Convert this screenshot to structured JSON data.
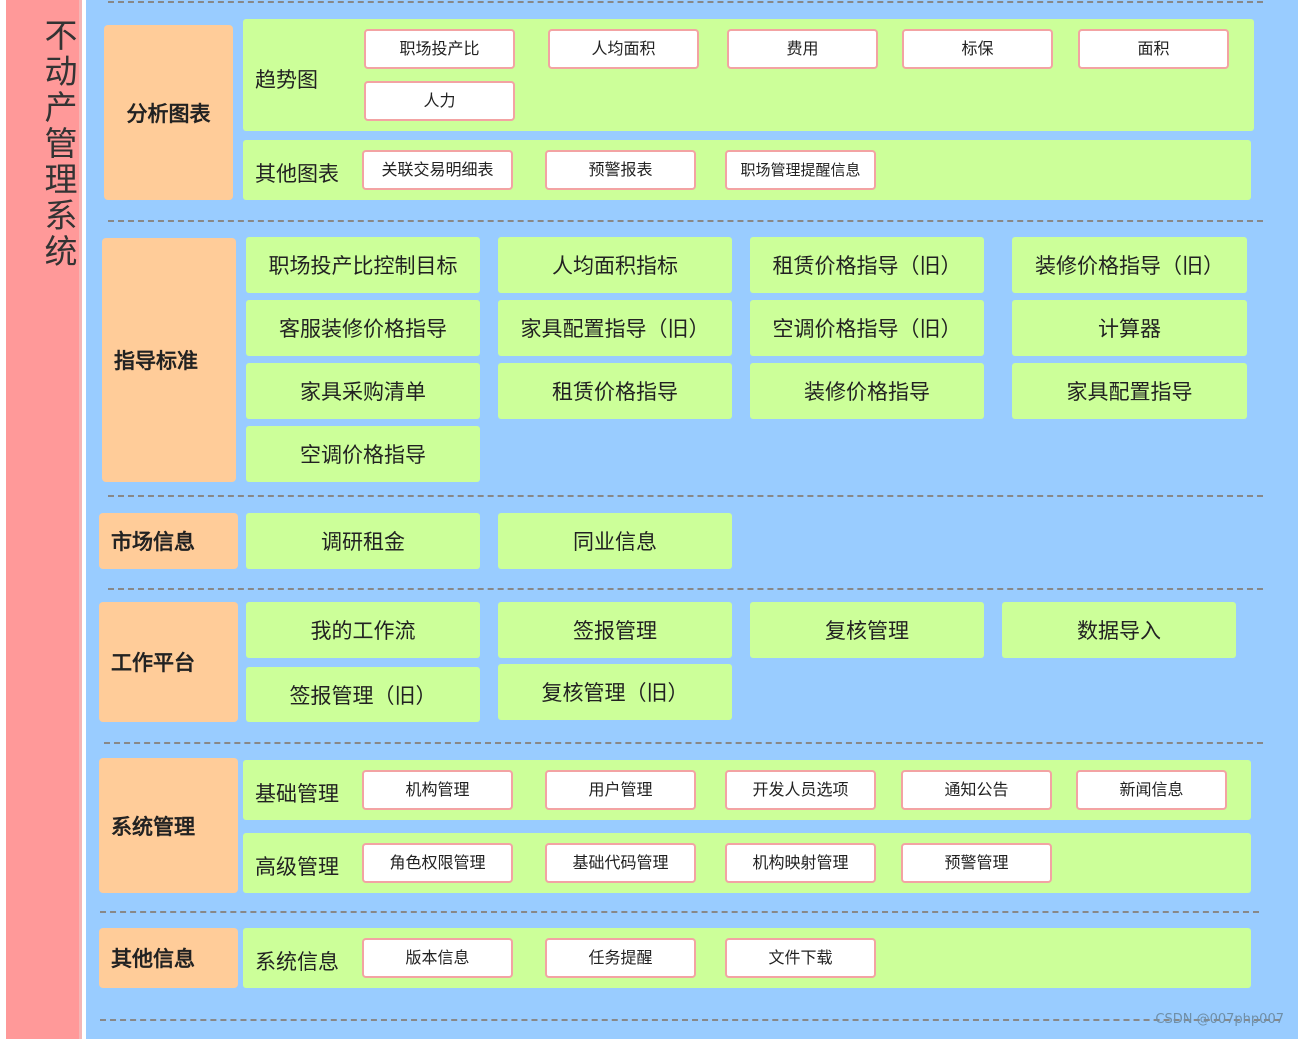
{
  "system_title": "不动产管理系统",
  "analysis": {
    "label": "分析图表",
    "trend_label": "趋势图",
    "trend_items": [
      "职场投产比",
      "人均面积",
      "费用",
      "标保",
      "面积",
      "人力"
    ],
    "other_label": "其他图表",
    "other_items": [
      "关联交易明细表",
      "预警报表",
      "职场管理提醒信息"
    ]
  },
  "guidance": {
    "label": "指导标准",
    "items": [
      "职场投产比控制目标",
      "人均面积指标",
      "租赁价格指导（旧）",
      "装修价格指导（旧）",
      "客服装修价格指导",
      "家具配置指导（旧）",
      "空调价格指导（旧）",
      "计算器",
      "家具采购清单",
      "租赁价格指导",
      "装修价格指导",
      "家具配置指导",
      "空调价格指导"
    ]
  },
  "market": {
    "label": "市场信息",
    "items": [
      "调研租金",
      "同业信息"
    ]
  },
  "workbench": {
    "label": "工作平台",
    "items": [
      "我的工作流",
      "签报管理",
      "复核管理",
      "数据导入",
      "签报管理（旧）",
      "复核管理（旧）"
    ]
  },
  "sysmgmt": {
    "label": "系统管理",
    "basic_label": "基础管理",
    "basic_items": [
      "机构管理",
      "用户管理",
      "开发人员选项",
      "通知公告",
      "新闻信息"
    ],
    "advanced_label": "高级管理",
    "advanced_items": [
      "角色权限管理",
      "基础代码管理",
      "机构映射管理",
      "预警管理"
    ]
  },
  "other": {
    "label": "其他信息",
    "sysinfo_label": "系统信息",
    "sysinfo_items": [
      "版本信息",
      "任务提醒",
      "文件下载"
    ]
  },
  "watermark": "CSDN @007php007"
}
